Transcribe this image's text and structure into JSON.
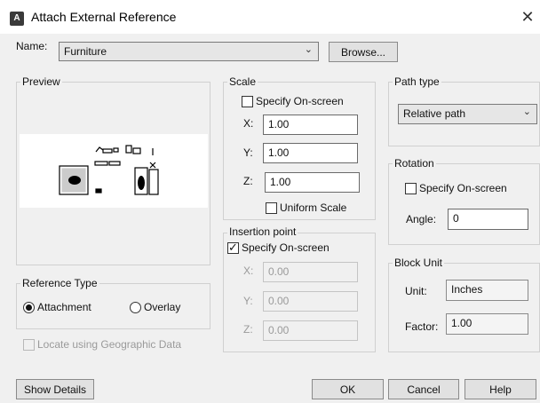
{
  "window": {
    "title": "Attach External Reference",
    "app_icon": "A"
  },
  "name_row": {
    "label": "Name:",
    "value": "Furniture",
    "browse_label": "Browse..."
  },
  "preview": {
    "title": "Preview"
  },
  "scale": {
    "title": "Scale",
    "specify_label": "Specify On-screen",
    "specify_checked": false,
    "x_label": "X:",
    "x_value": "1.00",
    "y_label": "Y:",
    "y_value": "1.00",
    "z_label": "Z:",
    "z_value": "1.00",
    "uniform_label": "Uniform Scale",
    "uniform_checked": false
  },
  "insertion": {
    "title": "Insertion point",
    "specify_label": "Specify On-screen",
    "specify_checked": true,
    "x_label": "X:",
    "x_value": "0.00",
    "y_label": "Y:",
    "y_value": "0.00",
    "z_label": "Z:",
    "z_value": "0.00"
  },
  "path_type": {
    "title": "Path type",
    "value": "Relative path"
  },
  "rotation": {
    "title": "Rotation",
    "specify_label": "Specify On-screen",
    "angle_label": "Angle:",
    "angle_value": "0"
  },
  "block_unit": {
    "title": "Block Unit",
    "unit_label": "Unit:",
    "unit_value": "Inches",
    "factor_label": "Factor:",
    "factor_value": "1.00"
  },
  "reference_type": {
    "title": "Reference Type",
    "attachment_label": "Attachment",
    "overlay_label": "Overlay",
    "selected": "Attachment"
  },
  "geo": {
    "label": "Locate using Geographic Data"
  },
  "buttons": {
    "show_details": "Show Details",
    "ok": "OK",
    "cancel": "Cancel",
    "help": "Help"
  },
  "icons": {
    "close": "close-icon",
    "dropdown": "chevron-down-icon",
    "app": "autocad-icon"
  }
}
